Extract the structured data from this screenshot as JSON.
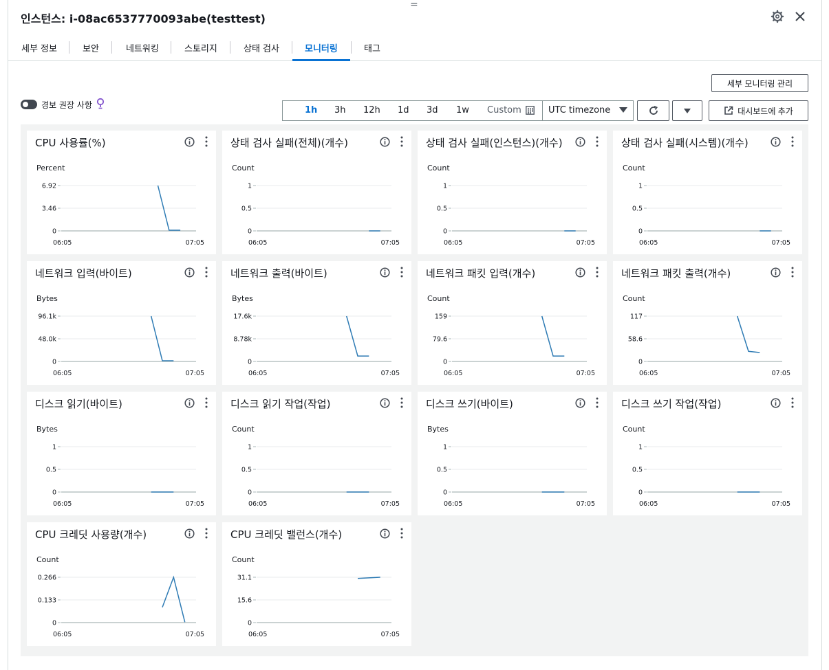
{
  "header": {
    "title": "인스턴스: i-08ac6537770093abe(testtest)"
  },
  "tabs": [
    {
      "label": "세부 정보",
      "active": false
    },
    {
      "label": "보안",
      "active": false
    },
    {
      "label": "네트워킹",
      "active": false
    },
    {
      "label": "스토리지",
      "active": false
    },
    {
      "label": "상태 검사",
      "active": false
    },
    {
      "label": "모니터링",
      "active": true
    },
    {
      "label": "태그",
      "active": false
    }
  ],
  "toolbar": {
    "manage_detailed_monitoring": "세부 모니터링 관리",
    "alarm_recommendations_label": "경보 권장 사항",
    "alarm_recommendations_on": false,
    "ranges": [
      "1h",
      "3h",
      "12h",
      "1d",
      "3d",
      "1w"
    ],
    "active_range": "1h",
    "custom_label": "Custom",
    "timezone": "UTC timezone",
    "add_to_dashboard": "대시보드에 추가"
  },
  "colors": {
    "accent": "#0972d3",
    "series_line": "#2e7bb4",
    "alarm_bulb": "#8456ce"
  },
  "chart_data": [
    {
      "type": "line",
      "title": "CPU 사용률(%)",
      "ylabel": "Percent",
      "yticks": [
        "6.92",
        "3.46",
        "0"
      ],
      "ylim": [
        0,
        6.92
      ],
      "xticks": [
        "06:05",
        "07:05"
      ],
      "xlim": [
        0,
        60
      ],
      "series": [
        {
          "x": [
            43,
            48,
            53
          ],
          "y": [
            6.92,
            0.1,
            0.1
          ]
        }
      ]
    },
    {
      "type": "line",
      "title": "상태 검사 실패(전체)(개수)",
      "ylabel": "Count",
      "yticks": [
        "1",
        "0.5",
        "0"
      ],
      "ylim": [
        0,
        1
      ],
      "xticks": [
        "06:05",
        "07:05"
      ],
      "xlim": [
        0,
        60
      ],
      "series": [
        {
          "x": [
            50,
            55
          ],
          "y": [
            0,
            0
          ]
        }
      ]
    },
    {
      "type": "line",
      "title": "상태 검사 실패(인스턴스)(개수)",
      "ylabel": "Count",
      "yticks": [
        "1",
        "0.5",
        "0"
      ],
      "ylim": [
        0,
        1
      ],
      "xticks": [
        "06:05",
        "07:05"
      ],
      "xlim": [
        0,
        60
      ],
      "series": [
        {
          "x": [
            50,
            55
          ],
          "y": [
            0,
            0
          ]
        }
      ]
    },
    {
      "type": "line",
      "title": "상태 검사 실패(시스템)(개수)",
      "ylabel": "Count",
      "yticks": [
        "1",
        "0.5",
        "0"
      ],
      "ylim": [
        0,
        1
      ],
      "xticks": [
        "06:05",
        "07:05"
      ],
      "xlim": [
        0,
        60
      ],
      "series": [
        {
          "x": [
            50,
            55
          ],
          "y": [
            0,
            0
          ]
        }
      ]
    },
    {
      "type": "line",
      "title": "네트워크 입력(바이트)",
      "ylabel": "Bytes",
      "yticks": [
        "96.1k",
        "48.0k",
        "0"
      ],
      "ylim": [
        0,
        96100
      ],
      "xticks": [
        "06:05",
        "07:05"
      ],
      "xlim": [
        0,
        60
      ],
      "series": [
        {
          "x": [
            40,
            45,
            50
          ],
          "y": [
            96100,
            1500,
            1500
          ]
        }
      ]
    },
    {
      "type": "line",
      "title": "네트워크 출력(바이트)",
      "ylabel": "Bytes",
      "yticks": [
        "17.6k",
        "8.78k",
        "0"
      ],
      "ylim": [
        0,
        17600
      ],
      "xticks": [
        "06:05",
        "07:05"
      ],
      "xlim": [
        0,
        60
      ],
      "series": [
        {
          "x": [
            40,
            45,
            50
          ],
          "y": [
            17600,
            2100,
            2100
          ]
        }
      ]
    },
    {
      "type": "line",
      "title": "네트워크 패킷 입력(개수)",
      "ylabel": "Count",
      "yticks": [
        "159",
        "79.6",
        "0"
      ],
      "ylim": [
        0,
        159
      ],
      "xticks": [
        "06:05",
        "07:05"
      ],
      "xlim": [
        0,
        60
      ],
      "series": [
        {
          "x": [
            40,
            45,
            50
          ],
          "y": [
            159,
            19,
            19
          ]
        }
      ]
    },
    {
      "type": "line",
      "title": "네트워크 패킷 출력(개수)",
      "ylabel": "Count",
      "yticks": [
        "117",
        "58.6",
        "0"
      ],
      "ylim": [
        0,
        117
      ],
      "xticks": [
        "06:05",
        "07:05"
      ],
      "xlim": [
        0,
        60
      ],
      "series": [
        {
          "x": [
            40,
            45,
            50
          ],
          "y": [
            117,
            26,
            23
          ]
        }
      ]
    },
    {
      "type": "line",
      "title": "디스크 읽기(바이트)",
      "ylabel": "Bytes",
      "yticks": [
        "1",
        "0.5",
        "0"
      ],
      "ylim": [
        0,
        1
      ],
      "xticks": [
        "06:05",
        "07:05"
      ],
      "xlim": [
        0,
        60
      ],
      "series": [
        {
          "x": [
            40,
            50
          ],
          "y": [
            0,
            0
          ]
        }
      ]
    },
    {
      "type": "line",
      "title": "디스크 읽기 작업(작업)",
      "ylabel": "Count",
      "yticks": [
        "1",
        "0.5",
        "0"
      ],
      "ylim": [
        0,
        1
      ],
      "xticks": [
        "06:05",
        "07:05"
      ],
      "xlim": [
        0,
        60
      ],
      "series": [
        {
          "x": [
            40,
            50
          ],
          "y": [
            0,
            0
          ]
        }
      ]
    },
    {
      "type": "line",
      "title": "디스크 쓰기(바이트)",
      "ylabel": "Bytes",
      "yticks": [
        "1",
        "0.5",
        "0"
      ],
      "ylim": [
        0,
        1
      ],
      "xticks": [
        "06:05",
        "07:05"
      ],
      "xlim": [
        0,
        60
      ],
      "series": [
        {
          "x": [
            40,
            50
          ],
          "y": [
            0,
            0
          ]
        }
      ]
    },
    {
      "type": "line",
      "title": "디스크 쓰기 작업(작업)",
      "ylabel": "Count",
      "yticks": [
        "1",
        "0.5",
        "0"
      ],
      "ylim": [
        0,
        1
      ],
      "xticks": [
        "06:05",
        "07:05"
      ],
      "xlim": [
        0,
        60
      ],
      "series": [
        {
          "x": [
            40,
            50
          ],
          "y": [
            0,
            0
          ]
        }
      ]
    },
    {
      "type": "line",
      "title": "CPU 크레딧 사용량(개수)",
      "ylabel": "Count",
      "yticks": [
        "0.266",
        "0.133",
        "0"
      ],
      "ylim": [
        0,
        0.266
      ],
      "xticks": [
        "06:05",
        "07:05"
      ],
      "xlim": [
        0,
        60
      ],
      "series": [
        {
          "x": [
            45,
            50,
            55
          ],
          "y": [
            0.09,
            0.266,
            0.003
          ]
        }
      ]
    },
    {
      "type": "line",
      "title": "CPU 크레딧 밸런스(개수)",
      "ylabel": "Count",
      "yticks": [
        "31.1",
        "15.6",
        "0"
      ],
      "ylim": [
        0,
        31.1
      ],
      "xticks": [
        "06:05",
        "07:05"
      ],
      "xlim": [
        0,
        60
      ],
      "series": [
        {
          "x": [
            45,
            55
          ],
          "y": [
            30.3,
            31.1
          ]
        }
      ]
    }
  ]
}
